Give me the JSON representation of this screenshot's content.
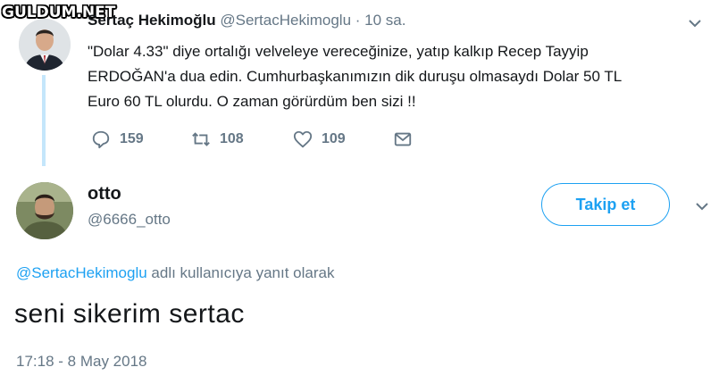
{
  "watermark": "GULDUM.NET",
  "quoted_tweet": {
    "name": "Sertaç Hekimoğlu",
    "handle": "@SertacHekimoglu",
    "separator": " · ",
    "time": "10 sa.",
    "text_lines": [
      "\"Dolar 4.33\" diye ortalığı velveleye vereceğinize, yatıp kalkıp Recep Tayyip",
      "ERDOĞAN'a dua edin. Cumhurbaşkanımızın dik duruşu olmasaydı Dolar 50 TL",
      "Euro 60 TL olurdu. O zaman görürdüm ben sizi !!"
    ],
    "actions": {
      "replies": "159",
      "retweets": "108",
      "likes": "109"
    }
  },
  "reply_tweet": {
    "name": "otto",
    "handle": "@6666_otto",
    "follow_label": "Takip et",
    "reply_to_mention": "@SertacHekimoglu",
    "reply_to_suffix": " adlı kullanıcıya yanıt olarak",
    "text": "seni sikerim sertac",
    "timestamp": "17:18 - 8 May 2018"
  },
  "colors": {
    "accent": "#1da1f2",
    "secondary_text": "#657786",
    "primary_text": "#14171a",
    "thread_line": "#c4e6fb"
  }
}
